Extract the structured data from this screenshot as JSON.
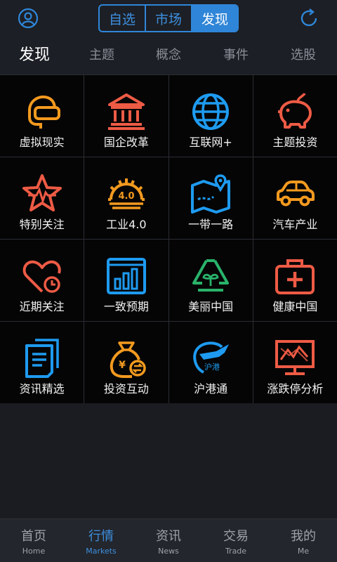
{
  "header": {
    "avatar_icon": "user-circle-icon",
    "refresh_icon": "refresh-icon",
    "segments": [
      "自选",
      "市场",
      "发现"
    ],
    "active_segment": "发现",
    "accent": "#2f86d8"
  },
  "subtabs": [
    "发现",
    "主题",
    "概念",
    "事件",
    "选股"
  ],
  "grid": [
    {
      "label": "虚拟现实",
      "icon": "vr-headset-icon",
      "color": "#f39a1f"
    },
    {
      "label": "国企改革",
      "icon": "bank-building-icon",
      "color": "#ee5b45"
    },
    {
      "label": "互联网+",
      "icon": "globe-icon",
      "color": "#1e9bf0"
    },
    {
      "label": "主题投资",
      "icon": "piggy-bank-icon",
      "color": "#ee5b45"
    },
    {
      "label": "特别关注",
      "icon": "star-pulse-icon",
      "color": "#ee5b45"
    },
    {
      "label": "工业4.0",
      "icon": "industry-gear-icon",
      "color": "#f39a1f",
      "icon_text": "4.0"
    },
    {
      "label": "一带一路",
      "icon": "route-map-icon",
      "color": "#1e9bf0"
    },
    {
      "label": "汽车产业",
      "icon": "car-icon",
      "color": "#f39a1f"
    },
    {
      "label": "近期关注",
      "icon": "heart-clock-icon",
      "color": "#ee5b45"
    },
    {
      "label": "一致预期",
      "icon": "bar-chart-news-icon",
      "color": "#1e9bf0"
    },
    {
      "label": "美丽中国",
      "icon": "recycle-leaf-icon",
      "color": "#29b36b"
    },
    {
      "label": "健康中国",
      "icon": "medical-kit-icon",
      "color": "#ee5b45"
    },
    {
      "label": "资讯精选",
      "icon": "documents-icon",
      "color": "#1e9bf0"
    },
    {
      "label": "投资互动",
      "icon": "money-bag-exchange-icon",
      "color": "#f39a1f",
      "icon_text": "¥"
    },
    {
      "label": "沪港通",
      "icon": "shanghai-hongkong-plane-icon",
      "color": "#1e9bf0",
      "icon_text": "沪港"
    },
    {
      "label": "涨跌停分析",
      "icon": "chart-monitor-icon",
      "color": "#ee5b45"
    }
  ],
  "bottom_nav": [
    {
      "cn": "首页",
      "en": "Home"
    },
    {
      "cn": "行情",
      "en": "Markets"
    },
    {
      "cn": "资讯",
      "en": "News"
    },
    {
      "cn": "交易",
      "en": "Trade"
    },
    {
      "cn": "我的",
      "en": "Me"
    }
  ],
  "bottom_nav_active": "行情"
}
